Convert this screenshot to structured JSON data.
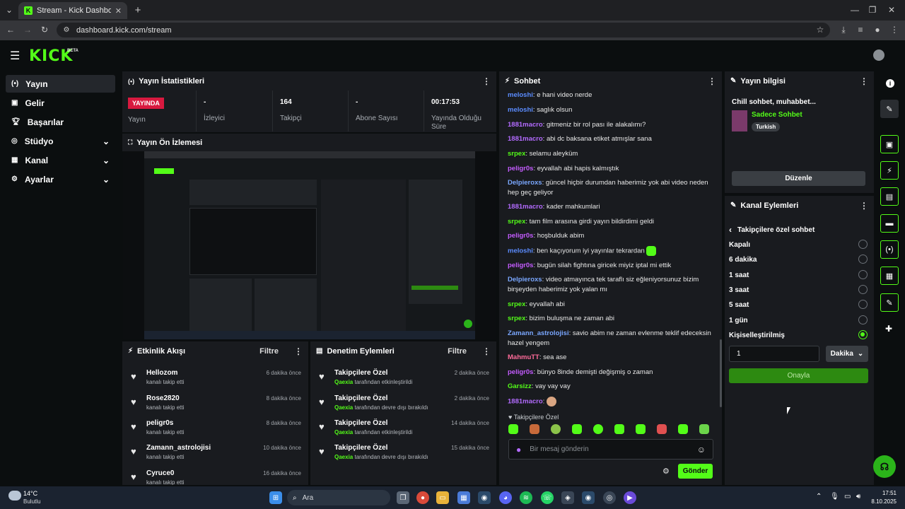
{
  "browser": {
    "tab_title": "Stream - Kick Dashboard",
    "url": "dashboard.kick.com/stream"
  },
  "site": {
    "logo": "KICK",
    "logo_badge": "BETA"
  },
  "sidebar": {
    "items": [
      {
        "label": "Yayın",
        "icon": "broadcast-icon",
        "active": true
      },
      {
        "label": "Gelir",
        "icon": "revenue-icon"
      },
      {
        "label": "Başarılar",
        "icon": "trophy-icon"
      },
      {
        "label": "Stüdyo",
        "icon": "studio-icon",
        "expandable": true
      },
      {
        "label": "Kanal",
        "icon": "channel-icon",
        "expandable": true
      },
      {
        "label": "Ayarlar",
        "icon": "gear-icon",
        "expandable": true
      }
    ]
  },
  "stats": {
    "title": "Yayın İstatistikleri",
    "live_badge": "YAYINDA",
    "items": [
      {
        "value": "",
        "label": "Yayın"
      },
      {
        "value": "-",
        "label": "İzleyici"
      },
      {
        "value": "164",
        "label": "Takipçi"
      },
      {
        "value": "-",
        "label": "Abone Sayısı"
      },
      {
        "value": "00:17:53",
        "label": "Yayında Olduğu Süre"
      }
    ]
  },
  "preview": {
    "title": "Yayın Ön İzlemesi"
  },
  "activity": {
    "title": "Etkinlik Akışı",
    "filter": "Filtre",
    "rows": [
      {
        "name": "Hellozom",
        "sub": "kanalı takip etti",
        "time": "6 dakika önce"
      },
      {
        "name": "Rose2820",
        "sub": "kanalı takip etti",
        "time": "8 dakika önce"
      },
      {
        "name": "peligr0s",
        "sub": "kanalı takip etti",
        "time": "8 dakika önce"
      },
      {
        "name": "Zamann_astrolojisi",
        "sub": "kanalı takip etti",
        "time": "10 dakika önce"
      },
      {
        "name": "Cyruce0",
        "sub": "kanalı takip etti",
        "time": "16 dakika önce"
      }
    ]
  },
  "moderation": {
    "title": "Denetim Eylemleri",
    "filter": "Filtre",
    "rows": [
      {
        "name": "Takipçilere Özel",
        "user": "Qaexia",
        "sub": "tarafından etkinleştirildi",
        "time": "2 dakika önce"
      },
      {
        "name": "Takipçilere Özel",
        "user": "Qaexia",
        "sub": "tarafından devre dışı bırakıldı",
        "time": "2 dakika önce"
      },
      {
        "name": "Takipçilere Özel",
        "user": "Qaexia",
        "sub": "tarafından etkinleştirildi",
        "time": "14 dakika önce"
      },
      {
        "name": "Takipçilere Özel",
        "user": "Qaexia",
        "sub": "tarafından devre dışı bırakıldı",
        "time": "15 dakika önce"
      }
    ]
  },
  "chat": {
    "title": "Sohbet",
    "messages": [
      {
        "user": "meloshi",
        "color": "#5b8cff",
        "text": "e hani video nerde"
      },
      {
        "user": "meloshi",
        "color": "#5b8cff",
        "text": "saglık olsun"
      },
      {
        "user": "1881macro",
        "color": "#b36bff",
        "text": "gitmeniz bir rol pası ile alakalımı?"
      },
      {
        "user": "1881macro",
        "color": "#b36bff",
        "text": "abi dc baksana etiket atmışlar sana"
      },
      {
        "user": "srpex",
        "color": "#53fc18",
        "text": "selamu aleyküm"
      },
      {
        "user": "peligr0s",
        "color": "#c45cff",
        "text": "eyvallah abi hapis kalmıştık"
      },
      {
        "user": "Delpieroxs",
        "color": "#7aa7ff",
        "text": "güncel hiçbir durumdan haberimiz yok abi video neden hep geç geliyor"
      },
      {
        "user": "1881macro",
        "color": "#b36bff",
        "text": "kader mahkumlari"
      },
      {
        "user": "srpex",
        "color": "#53fc18",
        "text": "tam film arasına girdi yayın bildirdimi geldi"
      },
      {
        "user": "peligr0s",
        "color": "#c45cff",
        "text": "hoşbulduk abim"
      },
      {
        "user": "meloshi",
        "color": "#5b8cff",
        "text": "ben kaçıyorum iyi yayınlar tekrardan"
      },
      {
        "user": "peligr0s",
        "color": "#c45cff",
        "text": "bugün silah fightına giricek miyiz iptal mi ettik"
      },
      {
        "user": "Delpieroxs",
        "color": "#7aa7ff",
        "text": "video atmayınca tek taraflı siz eğleniyorsunuz bizim birşeyden haberimiz yok yalan mı"
      },
      {
        "user": "srpex",
        "color": "#53fc18",
        "text": "eyvallah abi"
      },
      {
        "user": "srpex",
        "color": "#53fc18",
        "text": "bizim buluşma ne zaman abi"
      },
      {
        "user": "Zamann_astrolojisi",
        "color": "#7aa7ff",
        "text": "savio abim ne zaman evlenme teklif edeceksin hazel yengem"
      },
      {
        "user": "MahmuTT",
        "color": "#ff6b9a",
        "text": "sea ase"
      },
      {
        "user": "peligr0s",
        "color": "#c45cff",
        "text": "bünyo 8inde demişti değişmiş o zaman"
      },
      {
        "user": "Garsizz",
        "color": "#53fc18",
        "text": "vay vay vay"
      },
      {
        "user": "1881macro",
        "color": "#b36bff",
        "text": ""
      }
    ],
    "followers_only_label": "Takipçilere Özel",
    "input_placeholder": "Bir mesaj gönderin",
    "send_label": "Gönder"
  },
  "stream_info": {
    "title": "Yayın bilgisi",
    "stream_title": "Chill sohbet, muhabbet...",
    "category": "Sadece Sohbet",
    "language_tag": "Turkish",
    "edit_label": "Düzenle"
  },
  "channel_actions": {
    "title": "Kanal Eylemleri",
    "section": "Takipçilere özel sohbet",
    "options": [
      {
        "label": "Kapalı",
        "selected": false
      },
      {
        "label": "6 dakika",
        "selected": false
      },
      {
        "label": "1 saat",
        "selected": false
      },
      {
        "label": "3 saat",
        "selected": false
      },
      {
        "label": "5 saat",
        "selected": false
      },
      {
        "label": "1 gün",
        "selected": false
      },
      {
        "label": "Kişiselleştirilmiş",
        "selected": true
      }
    ],
    "custom_value": "1",
    "unit": "Dakika",
    "confirm_label": "Onayla"
  },
  "taskbar": {
    "weather_temp": "14°C",
    "weather_text": "Bulutlu",
    "search_label": "Ara",
    "time": "17:51",
    "date": "8.10.2025"
  },
  "colors": {
    "accent": "#53fc18",
    "live": "#d8193f",
    "panel": "#191b1f",
    "background": "#0b0e0f"
  }
}
